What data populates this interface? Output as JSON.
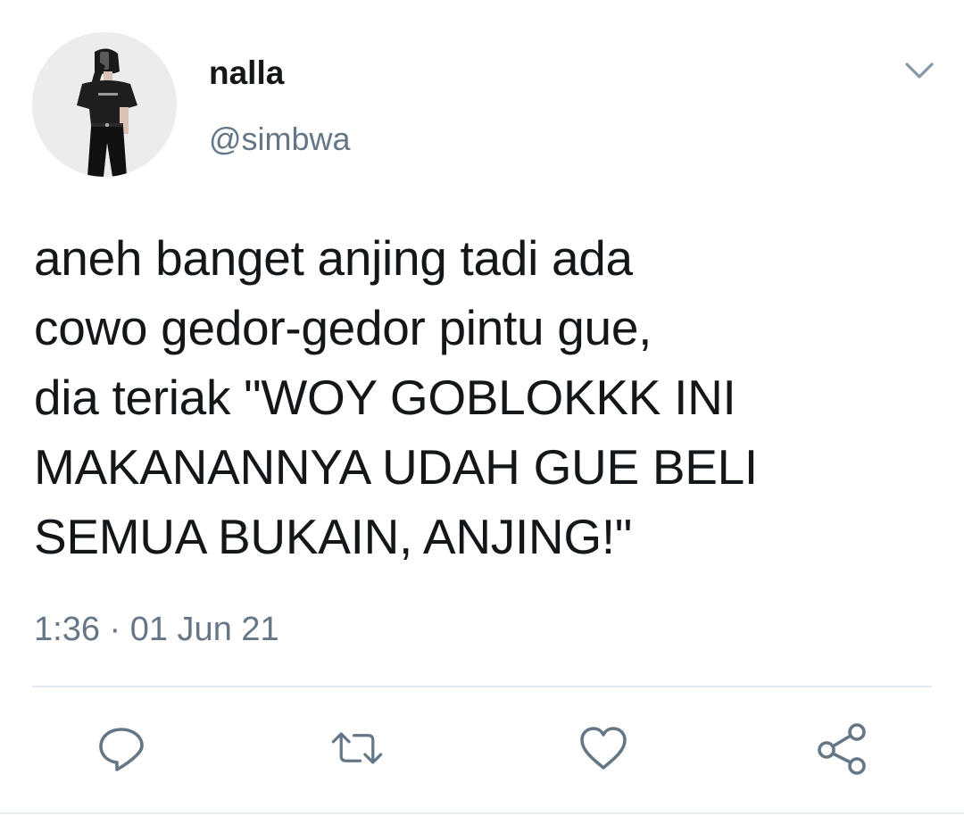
{
  "user": {
    "display_name": "nalla",
    "handle": "@simbwa"
  },
  "tweet": {
    "text": "aneh banget anjing tadi ada\ncowo gedor-gedor pintu gue,\ndia teriak \"WOY GOBLOKKK INI\nMAKANANNYA UDAH GUE BELI\nSEMUA BUKAIN, ANJING!\"",
    "timestamp": "1:36 · 01 Jun 21"
  },
  "icons": {
    "menu": "chevron-down-icon",
    "reply": "reply-icon",
    "retweet": "retweet-icon",
    "like": "heart-icon",
    "share": "share-icon"
  },
  "colors": {
    "text": "#14171a",
    "secondary": "#657786",
    "divider": "#e1e8ed",
    "icon": "#657786"
  }
}
